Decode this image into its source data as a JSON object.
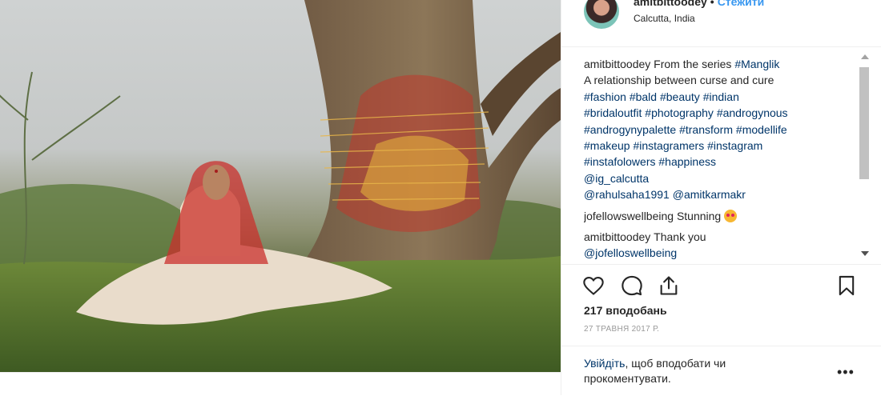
{
  "post": {
    "username": "amitbittoodey",
    "follow_label": "Стежити",
    "location": "Calcutta, India"
  },
  "comments": [
    {
      "user": "amitbittoodey",
      "lines": [
        [
          "From the series ",
          {
            "tag": "#Manglik"
          }
        ],
        [
          "A relationship between curse and cure"
        ],
        [
          {
            "tag": "#fashion"
          },
          " ",
          {
            "tag": "#bald"
          },
          " ",
          {
            "tag": "#beauty"
          },
          " ",
          {
            "tag": "#indian"
          }
        ],
        [
          {
            "tag": "#bridaloutfit"
          },
          " ",
          {
            "tag": "#photography"
          },
          " ",
          {
            "tag": "#androgynous"
          }
        ],
        [
          {
            "tag": "#androgynypalette"
          },
          " ",
          {
            "tag": "#transform"
          },
          " ",
          {
            "tag": "#modellife"
          }
        ],
        [
          {
            "tag": "#makeup"
          },
          " ",
          {
            "tag": "#instagramers"
          },
          " ",
          {
            "tag": "#instagram"
          }
        ],
        [
          {
            "tag": "#instafolowers"
          },
          " ",
          {
            "tag": "#happiness"
          }
        ],
        [
          {
            "tag": "@ig_calcutta"
          }
        ],
        [
          {
            "tag": "@rahulsaha1991"
          },
          " ",
          {
            "tag": "@amitkarmakr"
          }
        ]
      ]
    },
    {
      "user": "jofellowswellbeing",
      "lines": [
        [
          "Stunning ",
          {
            "emoji": "heart-eyes"
          }
        ]
      ]
    },
    {
      "user": "amitbittoodey",
      "lines": [
        [
          "Thank you"
        ],
        [
          {
            "tag": "@jofelloswellbeing"
          }
        ]
      ]
    }
  ],
  "likes_text": "217 вподобань",
  "date_text": "27 ТРАВНЯ 2017 Р.",
  "login_prompt": {
    "link": "Увійдіть",
    "rest": ", щоб вподобати чи прокоментувати."
  },
  "more_label": "•••",
  "icons": {
    "like": "heart-icon",
    "comment": "comment-icon",
    "share": "share-icon",
    "save": "bookmark-icon"
  },
  "colors": {
    "link": "#003569",
    "follow": "#3897f0"
  }
}
